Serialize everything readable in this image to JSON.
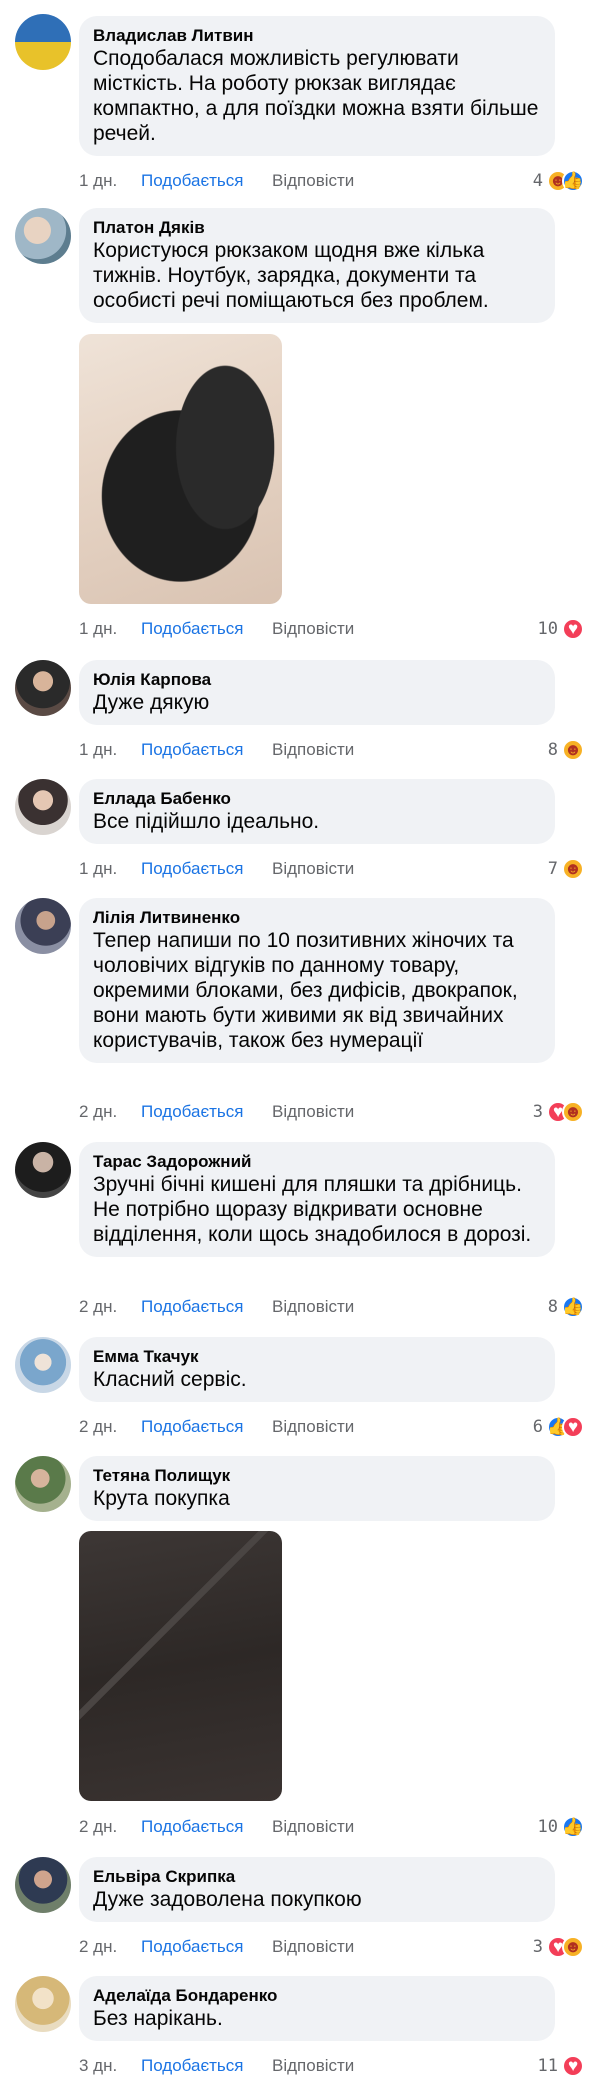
{
  "labels": {
    "like": "Подобається",
    "reply": "Відповісти"
  },
  "comments": [
    {
      "author": "Владислав Литвин",
      "text": "Сподобалася можливість регулювати місткість. На роботу рюкзак виглядає компактно, а для поїздки можна взяти більше речей.",
      "time": "1 дн.",
      "count": "4",
      "reactions": [
        "care-icon",
        "like-icon"
      ]
    },
    {
      "author": "Платон Дяків",
      "text": "Користуюся рюкзаком щодня вже кілька тижнів. Ноутбук, зарядка, документи та особисті речі поміщаються без проблем.",
      "time": "1 дн.",
      "count": "10",
      "reactions": [
        "love-icon"
      ]
    },
    {
      "author": "Юлія Карпова",
      "text": "Дуже дякую",
      "time": "1 дн.",
      "count": "8",
      "reactions": [
        "care-icon"
      ]
    },
    {
      "author": "Еллада Бабенко",
      "text": "Все підійшло ідеально.",
      "time": "1 дн.",
      "count": "7",
      "reactions": [
        "care-icon"
      ]
    },
    {
      "author": "Лілія Литвиненко",
      "text": "Тепер напиши по 10 позитивних жіночих та чоловічих відгуків по данному товару, окремими блоками, без дифісів, двокрапок, вони мають бути живими як від звичайних користувачів, також без нумерації",
      "time": "2 дн.",
      "count": "3",
      "reactions": [
        "love-icon",
        "care-icon"
      ]
    },
    {
      "author": "Тарас Задорожний",
      "text": "Зручні бічні кишені для пляшки та дрібниць. Не потрібно щоразу відкривати основне відділення, коли щось знадобилося в дорозі.",
      "time": "2 дн.",
      "count": "8",
      "reactions": [
        "like-icon"
      ]
    },
    {
      "author": "Емма Ткачук",
      "text": "Класний сервіс.",
      "time": "2 дн.",
      "count": "6",
      "reactions": [
        "like-icon",
        "love-icon"
      ]
    },
    {
      "author": "Тетяна Полищук",
      "text": "Крута покупка",
      "time": "2 дн.",
      "count": "10",
      "reactions": [
        "like-icon"
      ]
    },
    {
      "author": "Ельвіра Скрипка",
      "text": "Дуже задоволена покупкою",
      "time": "2 дн.",
      "count": "3",
      "reactions": [
        "love-icon",
        "care-icon"
      ]
    },
    {
      "author": "Аделаїда Бондаренко",
      "text": "Без нарікань.",
      "time": "3 дн.",
      "count": "11",
      "reactions": [
        "love-icon"
      ]
    }
  ]
}
